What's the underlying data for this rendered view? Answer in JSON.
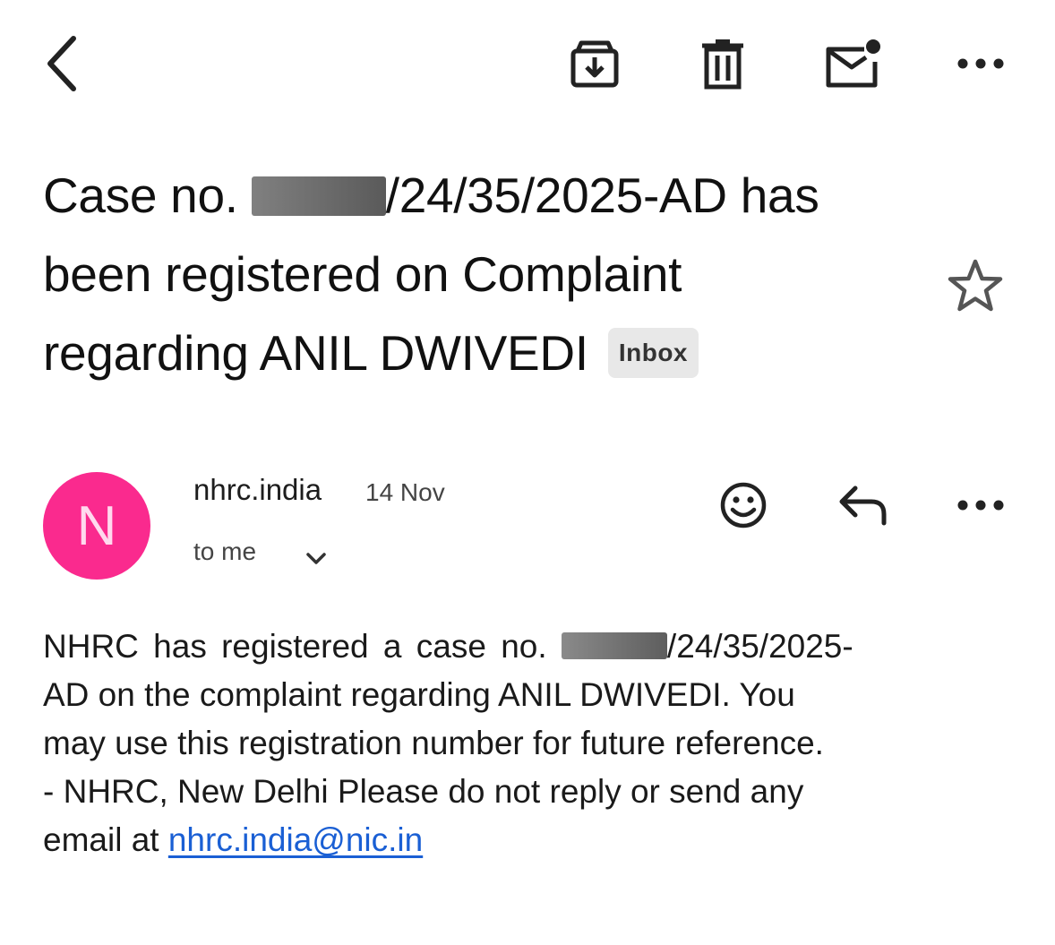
{
  "toolbar": {
    "back_icon": "chevron-left-icon",
    "archive_icon": "archive-icon",
    "delete_icon": "trash-icon",
    "unread_icon": "mark-unread-icon",
    "more_icon": "more-horizontal-icon"
  },
  "subject": {
    "line1_prefix": "Case no. ",
    "line1_suffix": "/24/35/2025-AD has",
    "line2": "been registered on Complaint",
    "line3": "regarding ANIL DWIVEDI",
    "label": "Inbox",
    "star_icon": "star-outline-icon"
  },
  "message": {
    "avatar_letter": "N",
    "avatar_color": "#fa2a8e",
    "sender": "nhrc.india",
    "date": "14 Nov",
    "recipient": "to me",
    "actions": {
      "emoji_icon": "emoji-reaction-icon",
      "reply_icon": "reply-icon",
      "more_icon": "more-horizontal-icon"
    },
    "body": {
      "line1_prefix": "NHRC has registered a case no. ",
      "line1_suffix": "/24/35/2025-",
      "line2": "AD on the complaint regarding ANIL DWIVEDI. You",
      "line3": "may use this registration number for future reference.",
      "line4": "- NHRC, New Delhi Please do not reply or send any",
      "line5_prefix": "email at ",
      "email_link": "nhrc.india@nic.in"
    }
  },
  "colors": {
    "link": "#1a5fd4",
    "label_chip_bg": "#e8e8e8",
    "redaction": "#6a6a6a"
  }
}
